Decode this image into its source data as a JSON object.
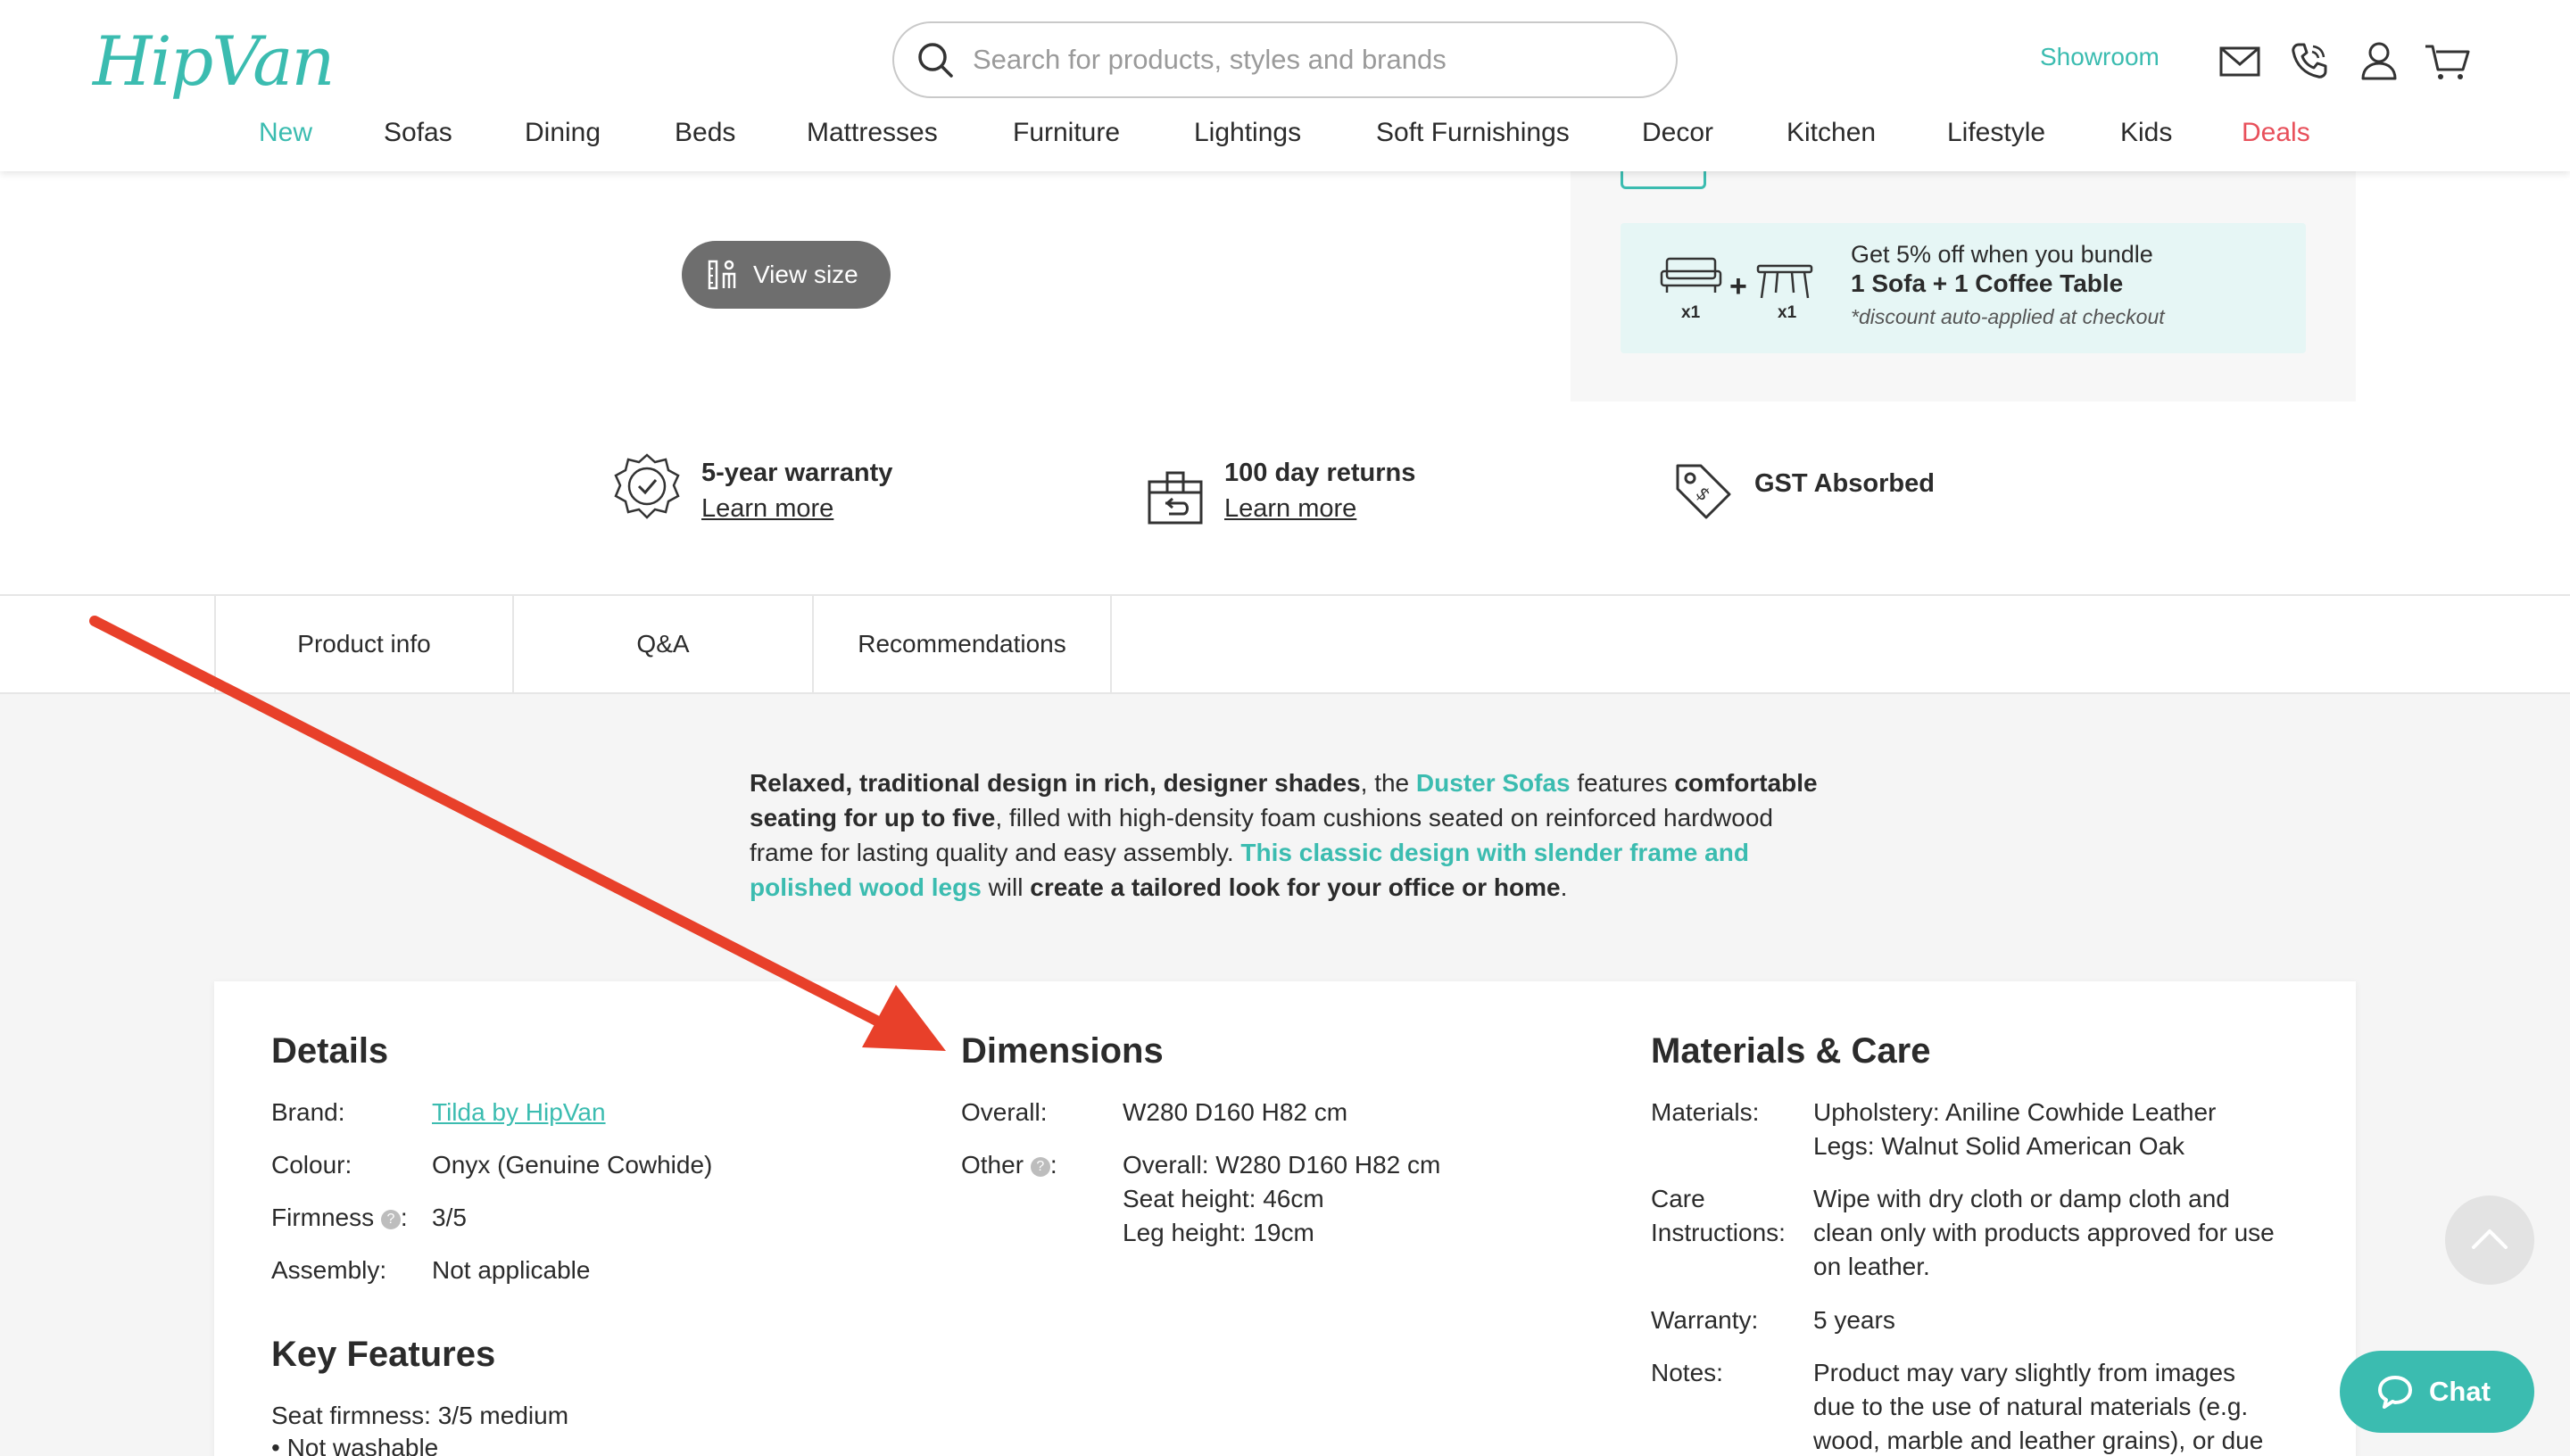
{
  "header": {
    "logo": "HipVan",
    "search_placeholder": "Search for products, styles and brands",
    "showroom": "Showroom",
    "nav": [
      {
        "label": "New",
        "style": "teal"
      },
      {
        "label": "Sofas",
        "style": "normal"
      },
      {
        "label": "Dining",
        "style": "normal"
      },
      {
        "label": "Beds",
        "style": "normal"
      },
      {
        "label": "Mattresses",
        "style": "normal"
      },
      {
        "label": "Furniture",
        "style": "normal"
      },
      {
        "label": "Lightings",
        "style": "normal"
      },
      {
        "label": "Soft Furnishings",
        "style": "normal"
      },
      {
        "label": "Decor",
        "style": "normal"
      },
      {
        "label": "Kitchen",
        "style": "normal"
      },
      {
        "label": "Lifestyle",
        "style": "normal"
      },
      {
        "label": "Kids",
        "style": "normal"
      },
      {
        "label": "Deals",
        "style": "red"
      }
    ]
  },
  "product": {
    "view_size": "View size",
    "bundle": {
      "title": "Get 5% off when you bundle",
      "subtitle": "1 Sofa + 1 Coffee Table",
      "note": "*discount auto-applied at checkout",
      "qty_a": "x1",
      "qty_b": "x1",
      "plus": "+"
    },
    "perks": [
      {
        "title": "5-year warranty",
        "link": "Learn more"
      },
      {
        "title": "100 day returns",
        "link": "Learn more"
      },
      {
        "title": "GST Absorbed",
        "link": ""
      }
    ]
  },
  "tabs": [
    "Product info",
    "Q&A",
    "Recommendations"
  ],
  "description": {
    "p1_bold": "Relaxed, traditional design in rich, designer shades",
    "p1_mid": ", the ",
    "p1_link": "Duster Sofas",
    "p1_after": " features ",
    "p1_bold2": "comfortable seating for up to five",
    "p1_rest": ", filled with high-density foam cushions seated on reinforced hardwood frame for lasting quality and easy assembly. ",
    "p1_teal": "This classic design with slender frame and polished wood legs",
    "p1_will": " will ",
    "p1_bold3": "create a tailored look for your office or home",
    "p1_end": "."
  },
  "details": {
    "title": "Details",
    "rows": [
      {
        "label": "Brand:",
        "value": "Tilda by HipVan"
      },
      {
        "label": "Colour:",
        "value": "Onyx (Genuine Cowhide)"
      },
      {
        "label": "Firmness",
        "value": "3/5"
      },
      {
        "label": "Assembly:",
        "value": "Not applicable"
      }
    ],
    "key_features_title": "Key Features",
    "key_features": [
      "Seat firmness: 3/5 medium",
      "• Not washable"
    ]
  },
  "dimensions": {
    "title": "Dimensions",
    "overall_label": "Overall:",
    "overall_value": "W280 D160 H82 cm",
    "other_label": "Other",
    "other_lines": [
      "Overall: W280 D160 H82 cm",
      "Seat height: 46cm",
      "Leg height: 19cm"
    ]
  },
  "materials": {
    "title": "Materials & Care",
    "materials_label": "Materials:",
    "materials_lines": [
      "Upholstery: Aniline Cowhide Leather",
      "Legs: Walnut Solid American Oak"
    ],
    "care_label_1": "Care",
    "care_label_2": "Instructions:",
    "care_lines": [
      "Wipe with dry cloth or damp cloth and",
      "clean only with products approved for use",
      "on leather."
    ],
    "warranty_label": "Warranty:",
    "warranty_value": "5 years",
    "notes_label": "Notes:",
    "notes_lines": [
      "Product may vary slightly from images",
      "due to the use of natural materials (e.g.",
      "wood, marble and leather grains), or due"
    ]
  },
  "chat": "Chat",
  "colors": {
    "brand": "#3bbcb0",
    "deals": "#e8505b",
    "arrow": "#e8402a"
  },
  "icons": [
    "search-icon",
    "mail-icon",
    "phone-icon",
    "user-icon",
    "cart-icon",
    "ruler-person-icon",
    "sofa-icon",
    "coffee-table-icon",
    "warranty-badge-icon",
    "returns-box-icon",
    "tag-icon",
    "chevron-up-icon",
    "chat-bubble-icon",
    "annotation-arrow"
  ]
}
